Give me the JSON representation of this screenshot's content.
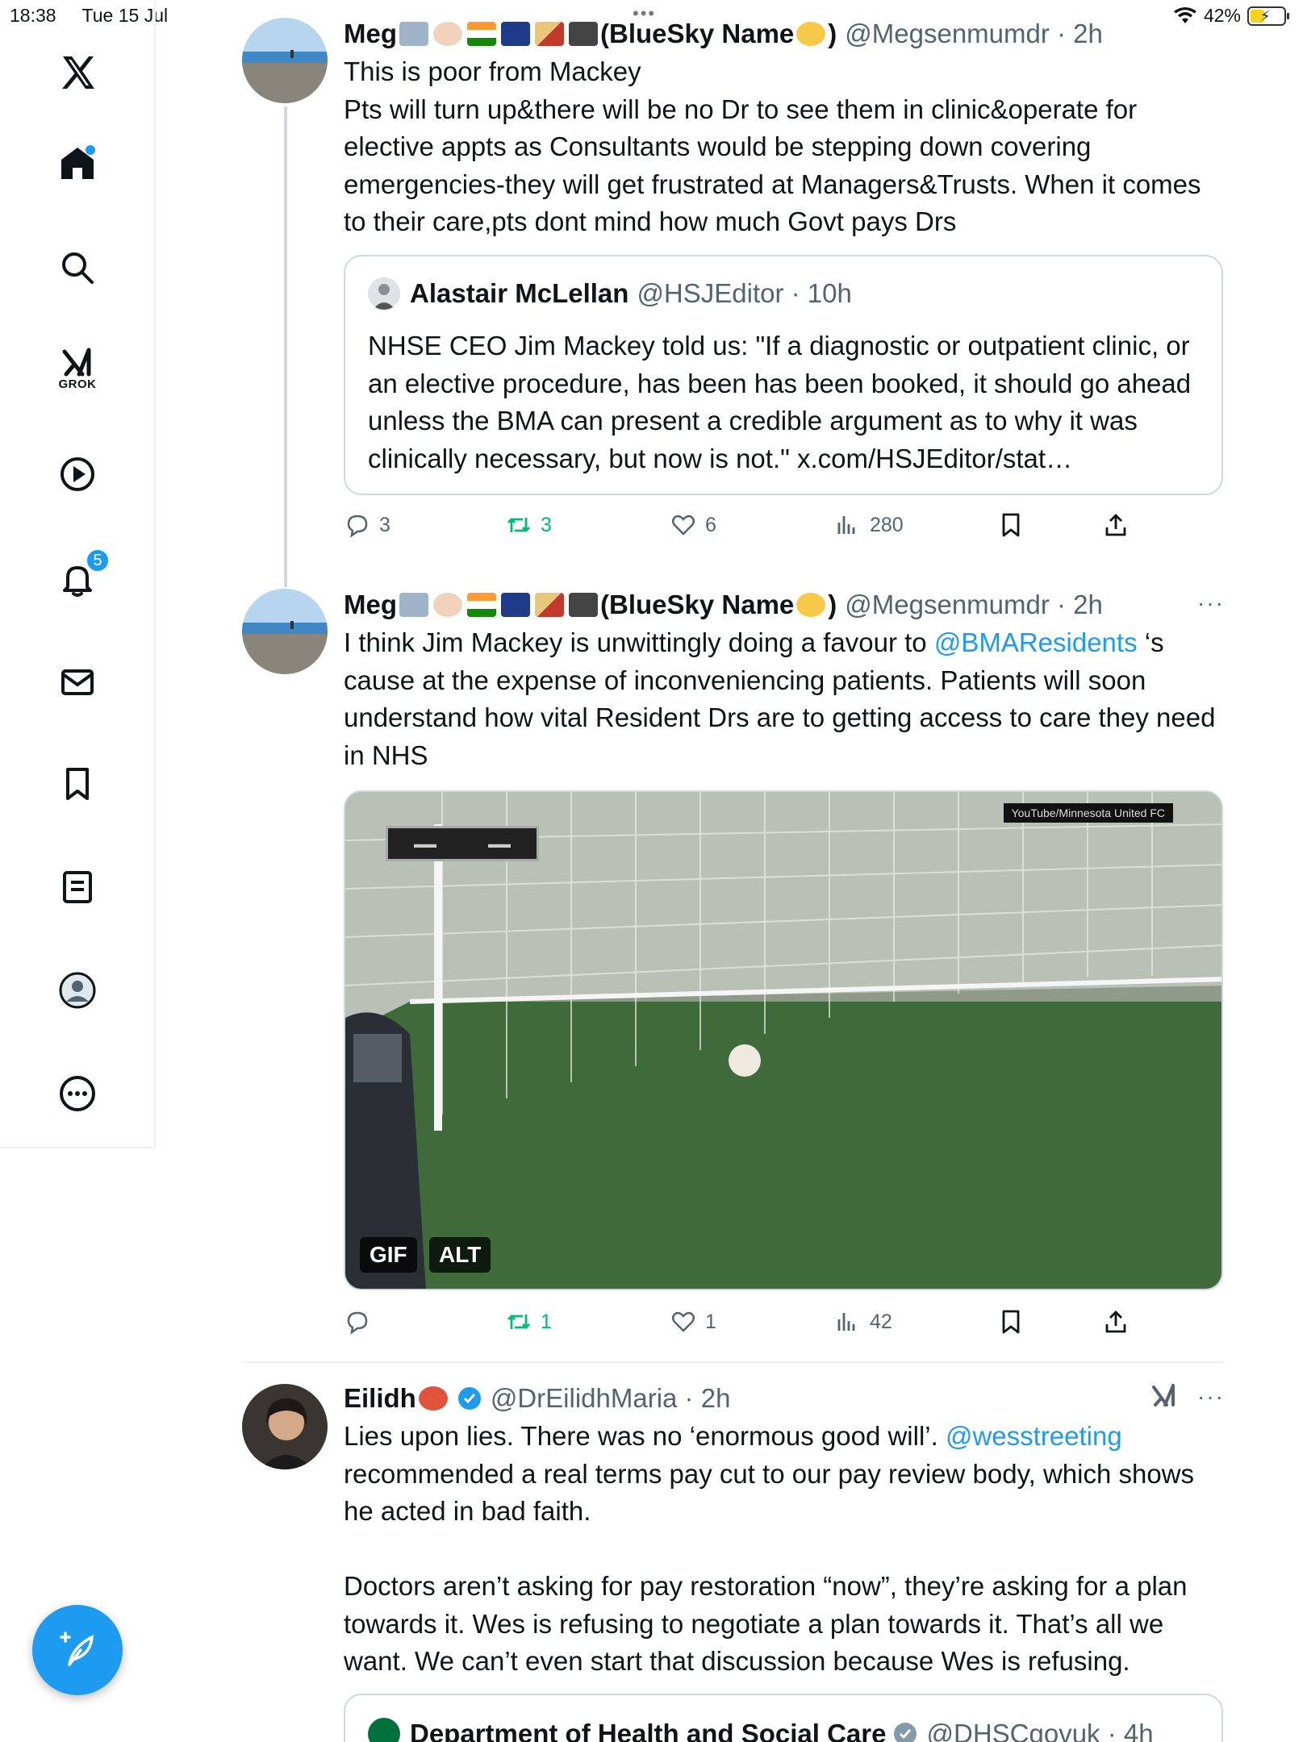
{
  "status_bar": {
    "time": "18:38",
    "date": "Tue 15 Jul",
    "battery": "42%",
    "battery_level": 0.42
  },
  "sidebar": {
    "notifications_count": "5",
    "grok_label": "GROK"
  },
  "colors": {
    "accent": "#1d9bf0",
    "repost_green": "#00ba7c",
    "muted": "#536471"
  },
  "tweets": [
    {
      "name": "Meg",
      "name_suffix": "(BlueSky Name",
      "name_close": ")",
      "handle": "@Megsenmumdr · 2h",
      "text": "This is poor from Mackey\nPts will turn up&there will be no Dr to see them in clinic&operate for elective appts as Consultants would be stepping down covering emergencies-they will get frustrated at Managers&Trusts. When it comes to their care,pts dont mind how much Govt pays Drs",
      "quote": {
        "name": "Alastair McLellan",
        "handle": "@HSJEditor · 10h",
        "text": "NHSE CEO Jim Mackey told us: \"If a diagnostic or outpatient clinic, or an elective procedure, has been has been booked, it should go ahead unless the BMA can present a credible argument as to why it was clinically necessary, but now is not.\" x.com/HSJEditor/stat…"
      },
      "replies": "3",
      "reposts": "3",
      "likes": "6",
      "views": "280"
    },
    {
      "name": "Meg",
      "name_suffix": "(BlueSky Name",
      "name_close": ")",
      "handle": "@Megsenmumdr · 2h",
      "text_before": "I think Jim Mackey is unwittingly doing a favour to ",
      "mention": "@BMAResidents",
      "text_after": " ‘s cause at the expense of inconveniencing patients. Patients will soon understand how vital Resident Drs are to getting access to care they need in NHS",
      "media": {
        "tag_gif": "GIF",
        "tag_alt": "ALT",
        "watermark": "YouTube/Minnesota United FC"
      },
      "replies": "",
      "reposts": "1",
      "likes": "1",
      "views": "42"
    },
    {
      "name": "Eilidh",
      "handle": "@DrEilidhMaria · 2h",
      "text_before": "Lies upon lies. There was no ‘enormous good will’. ",
      "mention": "@wesstreeting",
      "text_after": " recommended a real terms pay cut to our pay review body, which shows he acted in bad faith.\n\nDoctors aren’t asking for pay restoration “now”, they’re asking for a plan towards it. Wes is refusing to negotiate a plan towards it. That’s all we want. We can’t even start that discussion because Wes is refusing.",
      "quote": {
        "name": "Department of Health and Social Care",
        "handle": "@DHSCgovuk · 4h"
      }
    }
  ]
}
